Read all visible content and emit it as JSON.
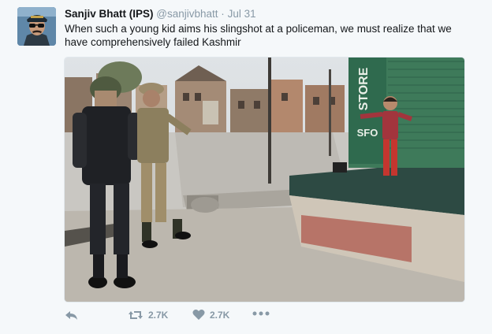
{
  "tweet": {
    "author_name": "Sanjiv Bhatt (IPS)",
    "author_handle": "@sanjivbhatt",
    "separator": "·",
    "timestamp": "Jul 31",
    "text": "When such a young kid aims his slingshot at a policeman, we must realize that we have comprehensively failed Kashmir",
    "shop_sign": {
      "top": "STORE",
      "bottom": "SFO"
    }
  },
  "actions": {
    "reply_icon": "reply-icon",
    "retweet_icon": "retweet-icon",
    "retweet_count": "2.7K",
    "like_icon": "heart-icon",
    "like_count": "2.7K",
    "more_icon": "more-icon"
  },
  "colors": {
    "background": "#f5f8fa",
    "name_text": "#14171a",
    "meta_text": "#8899a6",
    "action_gray": "#8899a6",
    "shutter_green": "#3e7a5a"
  }
}
